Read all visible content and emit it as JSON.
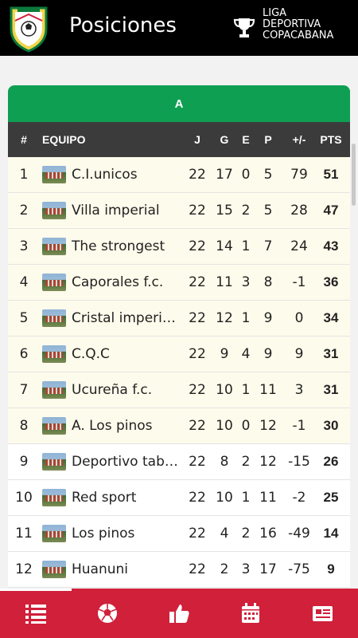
{
  "header": {
    "title": "Posiciones",
    "league_lines": [
      "LIGA",
      "DEPORTIVA",
      "COPACABANA"
    ],
    "logo_icon": "league-shield-logo",
    "trophy_icon": "trophy-icon"
  },
  "group": {
    "label": "A"
  },
  "table": {
    "columns": {
      "pos": "#",
      "team": "EQUIPO",
      "j": "J",
      "g": "G",
      "e": "E",
      "p": "P",
      "diff": "+/-",
      "pts": "PTS"
    },
    "rows": [
      {
        "pos": "1",
        "team": "C.I.unicos",
        "j": "22",
        "g": "17",
        "e": "0",
        "p": "5",
        "diff": "79",
        "pts": "51"
      },
      {
        "pos": "2",
        "team": "Villa imperial",
        "j": "22",
        "g": "15",
        "e": "2",
        "p": "5",
        "diff": "28",
        "pts": "47"
      },
      {
        "pos": "3",
        "team": "The strongest",
        "j": "22",
        "g": "14",
        "e": "1",
        "p": "7",
        "diff": "24",
        "pts": "43"
      },
      {
        "pos": "4",
        "team": "Caporales f.c.",
        "j": "22",
        "g": "11",
        "e": "3",
        "p": "8",
        "diff": "-1",
        "pts": "36"
      },
      {
        "pos": "5",
        "team": "Cristal imperi…",
        "j": "22",
        "g": "12",
        "e": "1",
        "p": "9",
        "diff": "0",
        "pts": "34"
      },
      {
        "pos": "6",
        "team": "C.Q.C",
        "j": "22",
        "g": "9",
        "e": "4",
        "p": "9",
        "diff": "9",
        "pts": "31"
      },
      {
        "pos": "7",
        "team": "Ucureña f.c.",
        "j": "22",
        "g": "10",
        "e": "1",
        "p": "11",
        "diff": "3",
        "pts": "31"
      },
      {
        "pos": "8",
        "team": "A. Los pinos",
        "j": "22",
        "g": "10",
        "e": "0",
        "p": "12",
        "diff": "-1",
        "pts": "30"
      },
      {
        "pos": "9",
        "team": "Deportivo tab…",
        "j": "22",
        "g": "8",
        "e": "2",
        "p": "12",
        "diff": "-15",
        "pts": "26"
      },
      {
        "pos": "10",
        "team": "Red sport",
        "j": "22",
        "g": "10",
        "e": "1",
        "p": "11",
        "diff": "-2",
        "pts": "25"
      },
      {
        "pos": "11",
        "team": "Los pinos",
        "j": "22",
        "g": "4",
        "e": "2",
        "p": "16",
        "diff": "-49",
        "pts": "14"
      },
      {
        "pos": "12",
        "team": "Huanuni",
        "j": "22",
        "g": "2",
        "e": "3",
        "p": "17",
        "diff": "-75",
        "pts": "9"
      }
    ]
  },
  "bottom_nav": {
    "items": [
      {
        "icon": "standings-list-icon",
        "active": true
      },
      {
        "icon": "soccer-ball-icon",
        "active": false
      },
      {
        "icon": "thumbs-up-icon",
        "active": false
      },
      {
        "icon": "calendar-icon",
        "active": false
      },
      {
        "icon": "news-icon",
        "active": false
      }
    ]
  },
  "colors": {
    "header_bg": "#000000",
    "group_green": "#0e9f52",
    "table_head": "#3b3b3b",
    "top_rows_bg": "#fdfbeb",
    "nav_red": "#d0203a"
  }
}
